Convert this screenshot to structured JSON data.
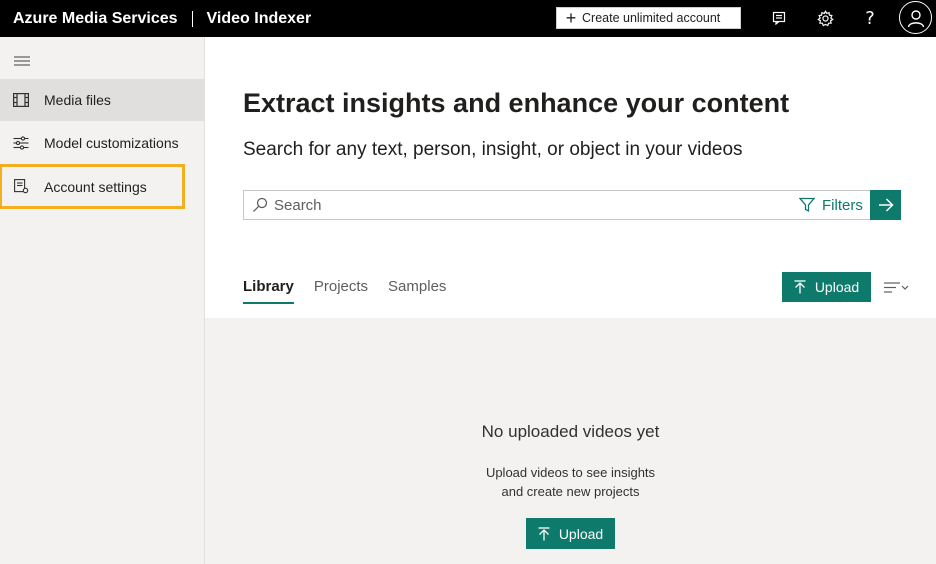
{
  "header": {
    "brand": "Azure Media Services",
    "product": "Video Indexer",
    "create_account_label": "Create unlimited account",
    "icons": [
      "feedback-icon",
      "settings-gear-icon",
      "help-icon",
      "user-avatar-icon"
    ]
  },
  "sidebar": {
    "items": [
      {
        "label": "Media files",
        "icon": "film-icon",
        "active": true
      },
      {
        "label": "Model customizations",
        "icon": "sliders-icon",
        "active": false
      },
      {
        "label": "Account settings",
        "icon": "account-settings-icon",
        "active": false,
        "highlighted": true
      }
    ]
  },
  "main": {
    "title": "Extract insights and enhance your content",
    "subtitle": "Search for any text, person, insight, or object in your videos",
    "search": {
      "placeholder": "Search",
      "filters_label": "Filters"
    },
    "tabs": [
      {
        "label": "Library",
        "active": true
      },
      {
        "label": "Projects",
        "active": false
      },
      {
        "label": "Samples",
        "active": false
      }
    ],
    "upload_label": "Upload",
    "empty_state": {
      "title": "No uploaded videos yet",
      "line1": "Upload videos to see insights",
      "line2": "and create new projects",
      "upload_label": "Upload"
    }
  },
  "colors": {
    "accent": "#0e7a6b",
    "topbar": "#000000",
    "sidebar_bg": "#f3f2f1",
    "highlight": "#f2b01e"
  }
}
